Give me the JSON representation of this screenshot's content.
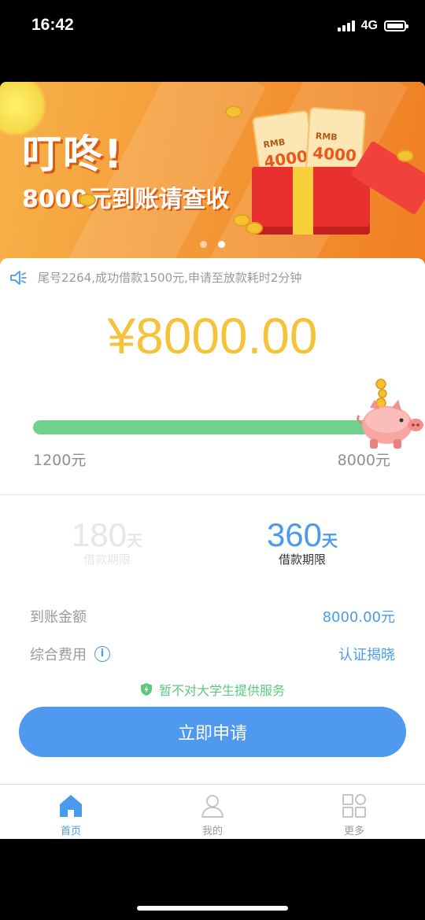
{
  "status_bar": {
    "time": "16:42",
    "network": "4G"
  },
  "banner": {
    "title": "叮咚!",
    "subtitle": "8000元到账请查收",
    "ticket_label": "RMB",
    "ticket_amount": "4000"
  },
  "notice": {
    "text": "尾号2264,成功借款1500元,申请至放款耗时2分钟"
  },
  "loan": {
    "amount": "¥8000.00",
    "slider_min": "1200元",
    "slider_max": "8000元",
    "slider_level": 1.0
  },
  "terms": [
    {
      "number": "180",
      "unit": "天",
      "label": "借款期限",
      "selected": false
    },
    {
      "number": "360",
      "unit": "天",
      "label": "借款期限",
      "selected": true
    }
  ],
  "details": {
    "received_label": "到账金额",
    "received_value": "8000.00元",
    "fee_label": "综合费用",
    "fee_value": "认证揭晓"
  },
  "warning": {
    "text": "暂不对大学生提供服务"
  },
  "apply_button": {
    "label": "立即申请"
  },
  "tabbar": [
    {
      "label": "首页",
      "icon": "home-icon",
      "active": true
    },
    {
      "label": "我的",
      "icon": "user-icon",
      "active": false
    },
    {
      "label": "更多",
      "icon": "grid-icon",
      "active": false
    }
  ],
  "colors": {
    "accent_blue": "#4f99ee",
    "amount_yellow": "#f5c33a",
    "slider_green": "#6fd18d",
    "warning_green": "#5cc97f",
    "banner_orange": "#f49a38"
  }
}
